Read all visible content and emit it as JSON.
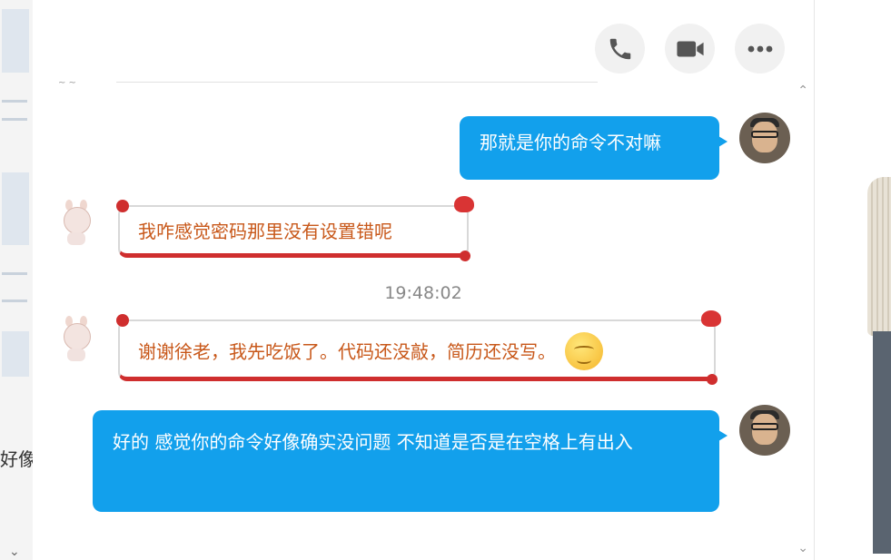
{
  "toolbar": {
    "phone_icon": "phone-icon",
    "video_icon": "video-camera-icon",
    "more_icon": "more-icon"
  },
  "background": {
    "left_partial_text": "好像"
  },
  "timestamp": "19:48:02",
  "messages": [
    {
      "direction": "out",
      "text": "那就是你的命令不对嘛"
    },
    {
      "direction": "in",
      "text": "我咋感觉密码那里没有设置错呢"
    },
    {
      "direction": "in",
      "text": "谢谢徐老，我先吃饭了。代码还没敲，简历还没写。",
      "emoji": "smile-emoji"
    },
    {
      "direction": "out",
      "text": "好的 感觉你的命令好像确实没问题 不知道是否是在空格上有出入"
    }
  ],
  "colors": {
    "outgoing_bubble": "#12a0ec",
    "incoming_text": "#c8581a",
    "incoming_border_accent": "#cf2e2e"
  }
}
